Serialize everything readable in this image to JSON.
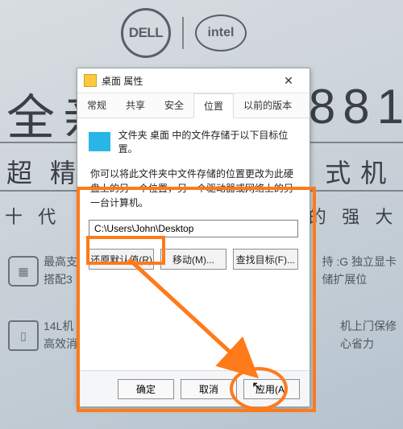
{
  "background": {
    "brand_dell": "DELL",
    "brand_intel": "intel",
    "headline_left": "全亲",
    "headline_right": "881",
    "subhead_left": "超",
    "subhead_mid": "精",
    "subhead_right1": "式",
    "subhead_right2": "机",
    "tagline_left": "十 代",
    "tagline_right": "的 强 大",
    "feat1_line1": "最高支",
    "feat1_line2": "搭配3",
    "feat2_line1": "持 :G 独立显卡",
    "feat2_line2": "储扩展位",
    "feat3_line1": "14L机",
    "feat3_line2": "高效消",
    "feat4_line1": "机上门保修",
    "feat4_line2": "心省力"
  },
  "dialog": {
    "title": "桌面 属性",
    "tabs": {
      "t1": "常规",
      "t2": "共享",
      "t3": "安全",
      "t4": "位置",
      "t5": "以前的版本"
    },
    "info_line": "文件夹 桌面 中的文件存储于以下目标位置。",
    "help_text": "你可以将此文件夹中文件存储的位置更改为此硬盘上的另一个位置，另一个驱动器或网络上的另一台计算机。",
    "path_value": "C:\\Users\\John\\Desktop",
    "buttons": {
      "restore": "还原默认值(R)",
      "move": "移动(M)...",
      "find": "查找目标(F)..."
    },
    "footer": {
      "ok": "确定",
      "cancel": "取消",
      "apply": "应用(A)"
    }
  }
}
